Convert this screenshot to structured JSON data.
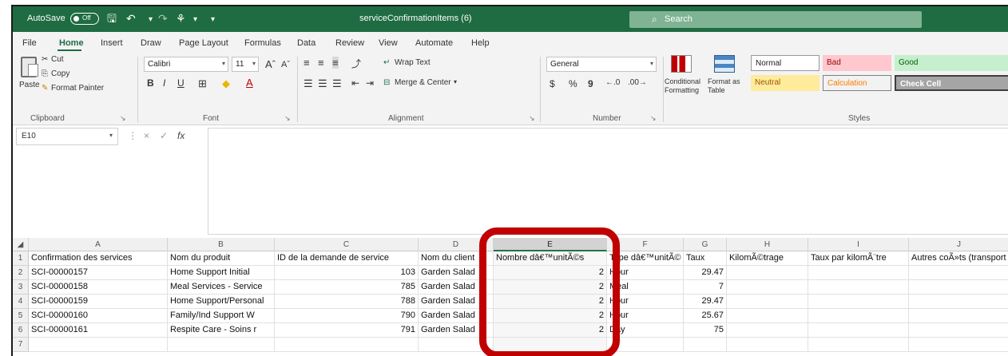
{
  "titlebar": {
    "autosave_label": "AutoSave",
    "autosave_state": "Off",
    "filename": "serviceConfirmationItems (6)",
    "search_placeholder": "Search"
  },
  "menu": [
    "File",
    "Home",
    "Insert",
    "Draw",
    "Page Layout",
    "Formulas",
    "Data",
    "Review",
    "View",
    "Automate",
    "Help"
  ],
  "active_menu": "Home",
  "ribbon": {
    "clipboard": {
      "paste": "Paste",
      "cut": "Cut",
      "copy": "Copy",
      "format_painter": "Format Painter",
      "label": "Clipboard"
    },
    "font": {
      "name": "Calibri",
      "size": "11",
      "grow": "Aˆ",
      "shrink": "Aˇ",
      "bold": "B",
      "italic": "I",
      "underline": "U",
      "label": "Font"
    },
    "alignment": {
      "wrap_text": "Wrap Text",
      "merge_center": "Merge & Center",
      "label": "Alignment"
    },
    "number": {
      "format": "General",
      "currency": "$",
      "percent": "%",
      "comma": "9",
      "label": "Number"
    },
    "styles": {
      "conditional": "Conditional Formatting",
      "format_as_table": "Format as Table",
      "normal": "Normal",
      "bad": "Bad",
      "good": "Good",
      "neutral": "Neutral",
      "calculation": "Calculation",
      "check_cell": "Check Cell",
      "label": "Styles"
    },
    "colors": {
      "accent": "#1f6b42",
      "bad_bg": "#ffc7ce",
      "bad_fg": "#9c0006",
      "good_bg": "#c6efce",
      "good_fg": "#006100",
      "neutral_bg": "#ffeb9c",
      "neutral_fg": "#9c5700",
      "calc_bg": "#f2f2f2",
      "calc_fg": "#fa7d00",
      "check_bg": "#a5a5a5"
    }
  },
  "formula_bar": {
    "name_box": "E10",
    "fx": "fx",
    "cancel": "×",
    "enter": "✓",
    "value": ""
  },
  "grid": {
    "columns": [
      "A",
      "B",
      "C",
      "D",
      "E",
      "F",
      "G",
      "H",
      "I",
      "J"
    ],
    "selected_column": "E",
    "headers": [
      "Confirmation des services",
      "Nom du produit",
      "ID de la demande de service",
      "Nom du client",
      "Nombre dâ€™unitÃ©s",
      "Type dâ€™unitÃ©",
      "Taux",
      "KilomÃ©trage",
      "Taux par kilomÃ¨tre",
      "Autres coÃ»ts (transport"
    ],
    "rows": [
      [
        "SCI-00000157",
        "Home Support Initial",
        "103",
        "Garden Salad",
        "2",
        "Hour",
        "29.47",
        "",
        "",
        ""
      ],
      [
        "SCI-00000158",
        "Meal Services - Service",
        "785",
        "Garden Salad",
        "2",
        "Meal",
        "7",
        "",
        "",
        ""
      ],
      [
        "SCI-00000159",
        "Home Support/Personal",
        "788",
        "Garden Salad",
        "2",
        "Hour",
        "29.47",
        "",
        "",
        ""
      ],
      [
        "SCI-00000160",
        "Family/Ind Support W",
        "790",
        "Garden Salad",
        "2",
        "Hour",
        "25.67",
        "",
        "",
        ""
      ],
      [
        "SCI-00000161",
        "Respite Care -  Soins r",
        "791",
        "Garden Salad",
        "2",
        "Day",
        "75",
        "",
        "",
        ""
      ]
    ],
    "row_numbers": [
      "1",
      "2",
      "3",
      "4",
      "5",
      "6",
      "7"
    ]
  },
  "annotation": {
    "highlight_color": "#c00000",
    "highlight_column": "E"
  }
}
